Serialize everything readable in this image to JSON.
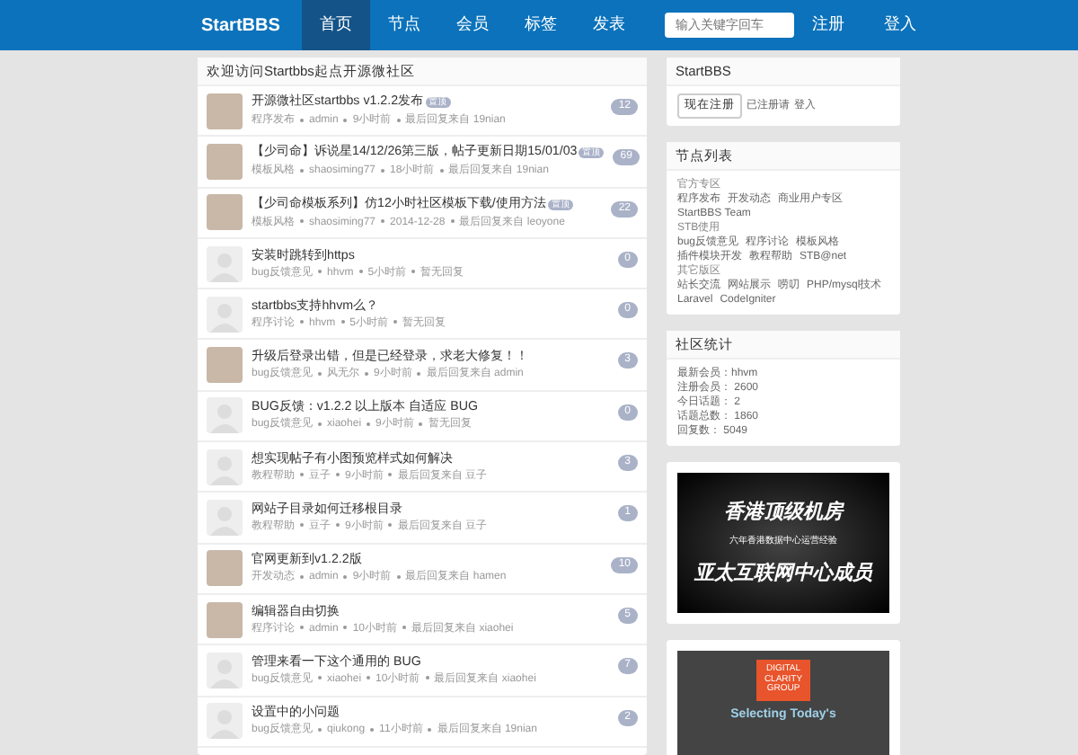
{
  "navbar": {
    "brand": "StartBBS",
    "items": [
      {
        "label": "首页",
        "selected": true
      },
      {
        "label": "节点",
        "selected": false
      },
      {
        "label": "会员",
        "selected": false
      },
      {
        "label": "标签",
        "selected": false
      },
      {
        "label": "发表",
        "selected": false
      }
    ],
    "search": {
      "placeholder": "输入关键字回车"
    },
    "right_links": [
      "注册",
      "登入"
    ]
  },
  "topics": {
    "title": "欢迎访问Startbbs起点开源微社区",
    "rows": [
      {
        "kind": "photo",
        "title": "开源微社区startbbs v1.2.2发布",
        "badge": "置顶",
        "category": "程序发布",
        "author": "admin",
        "time": "9小时前",
        "reply": "最后回复来自",
        "reply_user": "19nian",
        "count": "12"
      },
      {
        "kind": "photo",
        "title": "【少司命】诉说星14/12/26第三版，帖子更新日期15/01/03",
        "badge": "置顶",
        "category": "模板风格",
        "author": "shaosiming77",
        "time": "18小时前",
        "reply": "最后回复来自",
        "reply_user": "19nian",
        "count": "69"
      },
      {
        "kind": "photo",
        "title": "【少司命模板系列】仿12小时社区模板下载/使用方法",
        "badge": "置顶",
        "category": "模板风格",
        "author": "shaosiming77",
        "time": "2014-12-28",
        "reply": "最后回复来自",
        "reply_user": "leoyone",
        "count": "22"
      },
      {
        "kind": "default",
        "title": "安装时跳转到https",
        "category": "bug反馈意见",
        "author": "hhvm",
        "time": "5小时前",
        "reply": "暂无回复",
        "count": "0"
      },
      {
        "kind": "default",
        "title": "startbbs支持hhvm么？",
        "category": "程序讨论",
        "author": "hhvm",
        "time": "5小时前",
        "reply": "暂无回复",
        "count": "0"
      },
      {
        "kind": "photo",
        "title": "升级后登录出错，但是已经登录，求老大修复！！",
        "category": "bug反馈意见",
        "author": "风无尔",
        "time": "9小时前",
        "reply": "最后回复来自",
        "reply_user": "admin",
        "count": "3"
      },
      {
        "kind": "default",
        "title": "BUG反馈：v1.2.2 以上版本 自适应 BUG",
        "category": "bug反馈意见",
        "author": "xiaohei",
        "time": "9小时前",
        "reply": "暂无回复",
        "count": "0"
      },
      {
        "kind": "default",
        "title": "想实现帖子有小图预览样式如何解决",
        "category": "教程帮助",
        "author": "豆子",
        "time": "9小时前",
        "reply": "最后回复来自",
        "reply_user": "豆子",
        "count": "3"
      },
      {
        "kind": "default",
        "title": "网站子目录如何迁移根目录",
        "category": "教程帮助",
        "author": "豆子",
        "time": "9小时前",
        "reply": "最后回复来自",
        "reply_user": "豆子",
        "count": "1"
      },
      {
        "kind": "photo",
        "title": "官网更新到v1.2.2版",
        "category": "开发动态",
        "author": "admin",
        "time": "9小时前",
        "reply": "最后回复来自",
        "reply_user": "hamen",
        "count": "10"
      },
      {
        "kind": "photo",
        "title": "编辑器自由切换",
        "category": "程序讨论",
        "author": "admin",
        "time": "10小时前",
        "reply": "最后回复来自",
        "reply_user": "xiaohei",
        "count": "5"
      },
      {
        "kind": "default",
        "title": "管理来看一下这个通用的 BUG",
        "category": "bug反馈意见",
        "author": "xiaohei",
        "time": "10小时前",
        "reply": "最后回复来自",
        "reply_user": "xiaohei",
        "count": "7"
      },
      {
        "kind": "default",
        "title": "设置中的小问题",
        "category": "bug反馈意见",
        "author": "qiukong",
        "time": "11小时前",
        "reply": "最后回复来自",
        "reply_user": "19nian",
        "count": "2"
      }
    ]
  },
  "sidebar": {
    "account": {
      "title": "StartBBS",
      "button": "现在注册",
      "text": "已注册请",
      "link": "登入"
    },
    "nodes": {
      "title": "节点列表",
      "groups": [
        {
          "heading": "官方专区",
          "links": [
            "程序发布",
            "开发动态",
            "商业用户专区",
            "StartBBS Team"
          ]
        },
        {
          "heading": "STB使用",
          "links": [
            "bug反馈意见",
            "程序讨论",
            "模板风格",
            "插件模块开发",
            "教程帮助",
            "STB@net"
          ]
        },
        {
          "heading": "其它版区",
          "links": [
            "站长交流",
            "网站展示",
            "唠叨",
            "PHP/mysql技术",
            "Laravel",
            "CodeIgniter"
          ]
        }
      ]
    },
    "stats": {
      "title": "社区统计",
      "lines": [
        "最新会员：hhvm",
        "注册会员： 2600",
        "今日话题： 2",
        "话题总数： 1860",
        "回复数： 5049"
      ]
    },
    "ads": [
      {
        "kind": "hosting",
        "lines": [
          "香港顶级机房",
          "六年香港数据中心运营经验",
          "亚太互联网中心成员"
        ]
      },
      {
        "kind": "report",
        "logo": [
          "DIGITAL",
          "CLARITY",
          "GROUP"
        ],
        "lines": [
          "Selecting Today's"
        ]
      }
    ]
  }
}
